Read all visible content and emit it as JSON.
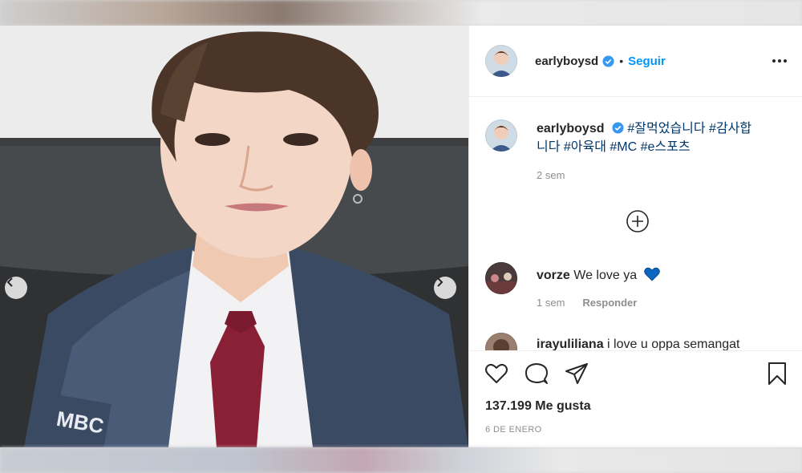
{
  "post": {
    "username": "earlyboysd",
    "follow_label": "Seguir",
    "separator": "•",
    "icons": {
      "verified": "verified-badge-icon",
      "more": "more-options-icon",
      "like": "heart-icon",
      "comment": "comment-icon",
      "share": "paper-plane-icon",
      "save": "bookmark-icon",
      "load_more": "plus-circle-icon",
      "prev": "chevron-left-icon",
      "next": "chevron-right-icon"
    },
    "caption": {
      "username": "earlyboysd",
      "hashtags_line1": "#잘먹었습니다 #감사합",
      "hashtags_line2": "니다 #아육대 #MC #e스포츠",
      "time": "2 sem"
    },
    "comments": [
      {
        "username": "vorze",
        "text": "We love ya",
        "time": "1 sem",
        "reply_label": "Responder"
      },
      {
        "username": "irayuliliana",
        "text": "i love u oppa semangat"
      }
    ],
    "likes": "137.199 Me gusta",
    "date": "6 DE ENERO",
    "colors": {
      "accent": "#0095f6",
      "text": "#262626",
      "muted": "#8e8e8e",
      "hashtag": "#00376b",
      "heart": "#0a66c2"
    }
  }
}
